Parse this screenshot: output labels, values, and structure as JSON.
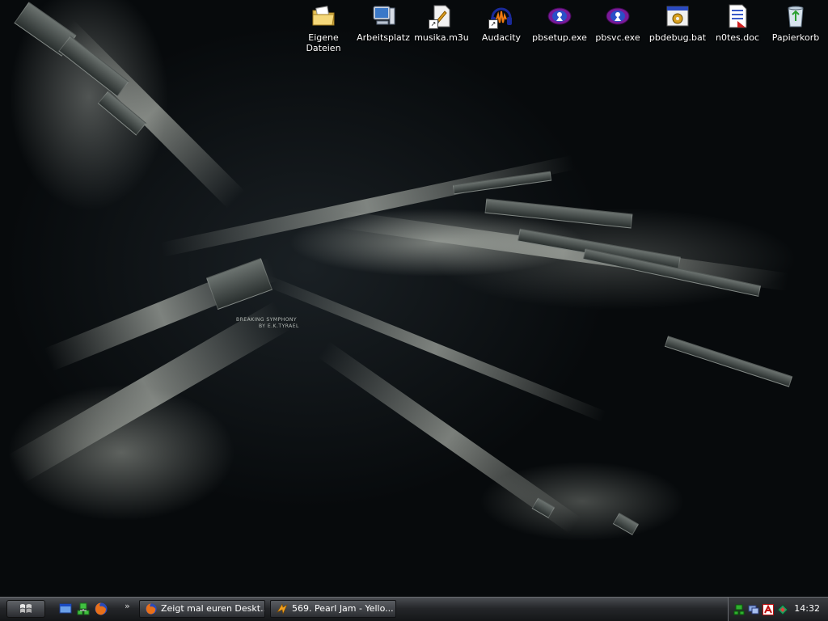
{
  "desktop": {
    "wallpaper_text_1": "BREAKING SYMPHONY",
    "wallpaper_text_2": "BY E.K.TYRAEL",
    "icons": [
      {
        "label": "Eigene Dateien",
        "icon": "my-documents-folder-icon"
      },
      {
        "label": "Arbeitsplatz",
        "icon": "my-computer-icon"
      },
      {
        "label": "musika.m3u",
        "icon": "playlist-file-icon"
      },
      {
        "label": "Audacity",
        "icon": "audacity-icon"
      },
      {
        "label": "pbsetup.exe",
        "icon": "pbsetup-exe-icon"
      },
      {
        "label": "pbsvc.exe",
        "icon": "pbsvc-exe-icon"
      },
      {
        "label": "pbdebug.bat",
        "icon": "batch-file-icon"
      },
      {
        "label": "n0tes.doc",
        "icon": "word-document-icon"
      },
      {
        "label": "Papierkorb",
        "icon": "recycle-bin-icon"
      }
    ]
  },
  "taskbar": {
    "start_icon": "windows-logo-icon",
    "quick_launch": [
      {
        "icon": "show-desktop-icon"
      },
      {
        "icon": "network-green-icon"
      },
      {
        "icon": "firefox-icon"
      }
    ],
    "more_glyph": "»",
    "tasks": [
      {
        "label": "Zeigt mal euren Deskt...",
        "icon": "firefox-icon"
      },
      {
        "label": "569. Pearl Jam - Yello...",
        "icon": "winamp-icon"
      }
    ],
    "tray": {
      "icons": [
        "network-icon",
        "display-icon",
        "antivirus-icon",
        "security-shield-icon"
      ],
      "clock": "14:32"
    }
  },
  "colors": {
    "taskbar_top": "#4a4d52",
    "taskbar_bottom": "#151618",
    "label_text": "#ffffff"
  }
}
